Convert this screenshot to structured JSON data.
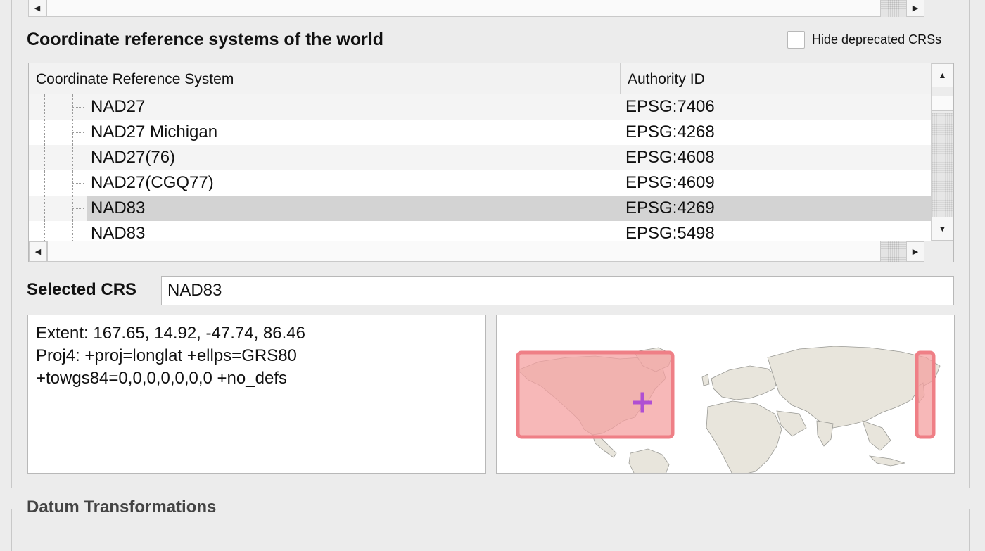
{
  "top_scrollbar": {
    "left_arrow": "◀",
    "right_arrow": "▶"
  },
  "crs_section": {
    "title": "Coordinate reference systems of the world",
    "hide_deprecated_label": "Hide deprecated CRSs",
    "hide_deprecated_checked": false
  },
  "crs_table": {
    "columns": [
      "Coordinate Reference System",
      "Authority ID"
    ],
    "rows": [
      {
        "name": "NAD27",
        "authority_id": "EPSG:7406",
        "selected": false
      },
      {
        "name": "NAD27 Michigan",
        "authority_id": "EPSG:4268",
        "selected": false
      },
      {
        "name": "NAD27(76)",
        "authority_id": "EPSG:4608",
        "selected": false
      },
      {
        "name": "NAD27(CGQ77)",
        "authority_id": "EPSG:4609",
        "selected": false
      },
      {
        "name": "NAD83",
        "authority_id": "EPSG:4269",
        "selected": true
      },
      {
        "name": "NAD83",
        "authority_id": "EPSG:5498",
        "selected": false
      }
    ],
    "scroll_up": "▲",
    "scroll_down": "▼",
    "scroll_left": "◀",
    "scroll_right": "▶"
  },
  "selected_crs": {
    "label": "Selected CRS",
    "value": "NAD83"
  },
  "crs_info": {
    "extent": "Extent: 167.65, 14.92, -47.74, 86.46",
    "proj4_line1": "Proj4: +proj=longlat +ellps=GRS80",
    "proj4_line2": "+towgs84=0,0,0,0,0,0,0 +no_defs"
  },
  "datum_section": {
    "title": "Datum Transformations"
  },
  "colors": {
    "selection": "#d3d3d3",
    "extent_fill": "#f4a0a0",
    "extent_stroke": "#ef7f86",
    "land": "#e8e5dc",
    "marker": "#b04fd3"
  }
}
